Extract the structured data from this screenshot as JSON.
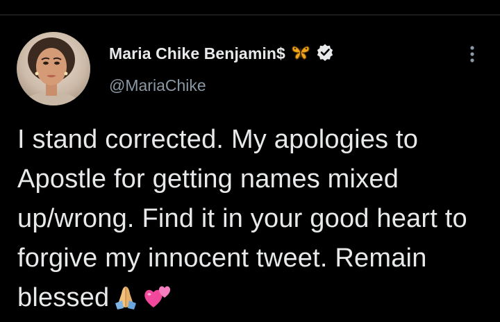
{
  "tweet": {
    "author": {
      "display_name": "Maria Chike Benjamin$",
      "handle": "@MariaChike",
      "name_emoji_icon": "butterfly-emoji-icon",
      "verified_icon": "verified-badge-icon"
    },
    "text": "I stand corrected. My apologies to Apostle for getting names mixed up/wrong. Find it in your good heart to forgive my innocent tweet. Remain blessed",
    "trailing_emojis": [
      "folded-hands-emoji-icon",
      "two-hearts-emoji-icon"
    ],
    "menu_icon": "more-options-icon"
  },
  "colors": {
    "background": "#000000",
    "primary_text": "#e7e9ea",
    "secondary_text": "#8b98a5",
    "divider": "#2f3336"
  }
}
